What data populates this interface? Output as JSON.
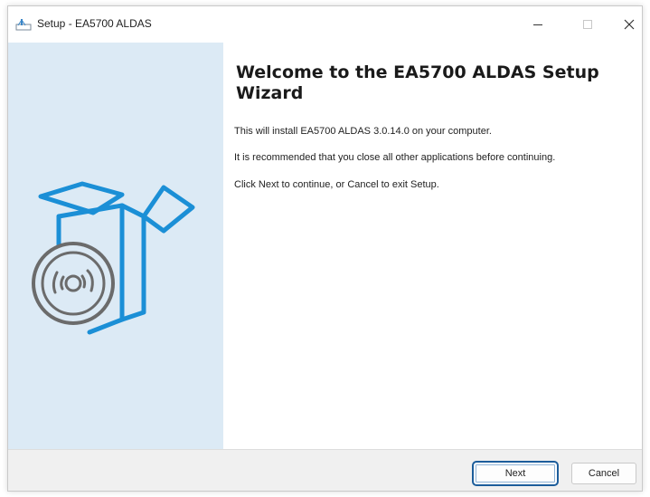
{
  "window": {
    "title": "Setup - EA5700 ALDAS",
    "controls": {
      "minimize": "minimize-icon",
      "maximize": "maximize-icon",
      "close": "close-icon"
    }
  },
  "main": {
    "heading": "Welcome to the EA5700 ALDAS Setup Wizard",
    "paragraphs": [
      "This will install EA5700 ALDAS 3.0.14.0 on your computer.",
      "It is recommended that you close all other applications before continuing.",
      "Click Next to continue, or Cancel to exit Setup."
    ]
  },
  "footer": {
    "next_label": "Next",
    "cancel_label": "Cancel"
  },
  "colors": {
    "side_panel": "#dceaf5",
    "illustration": "#1b8fd6",
    "focus_border": "#1c5d9b"
  }
}
